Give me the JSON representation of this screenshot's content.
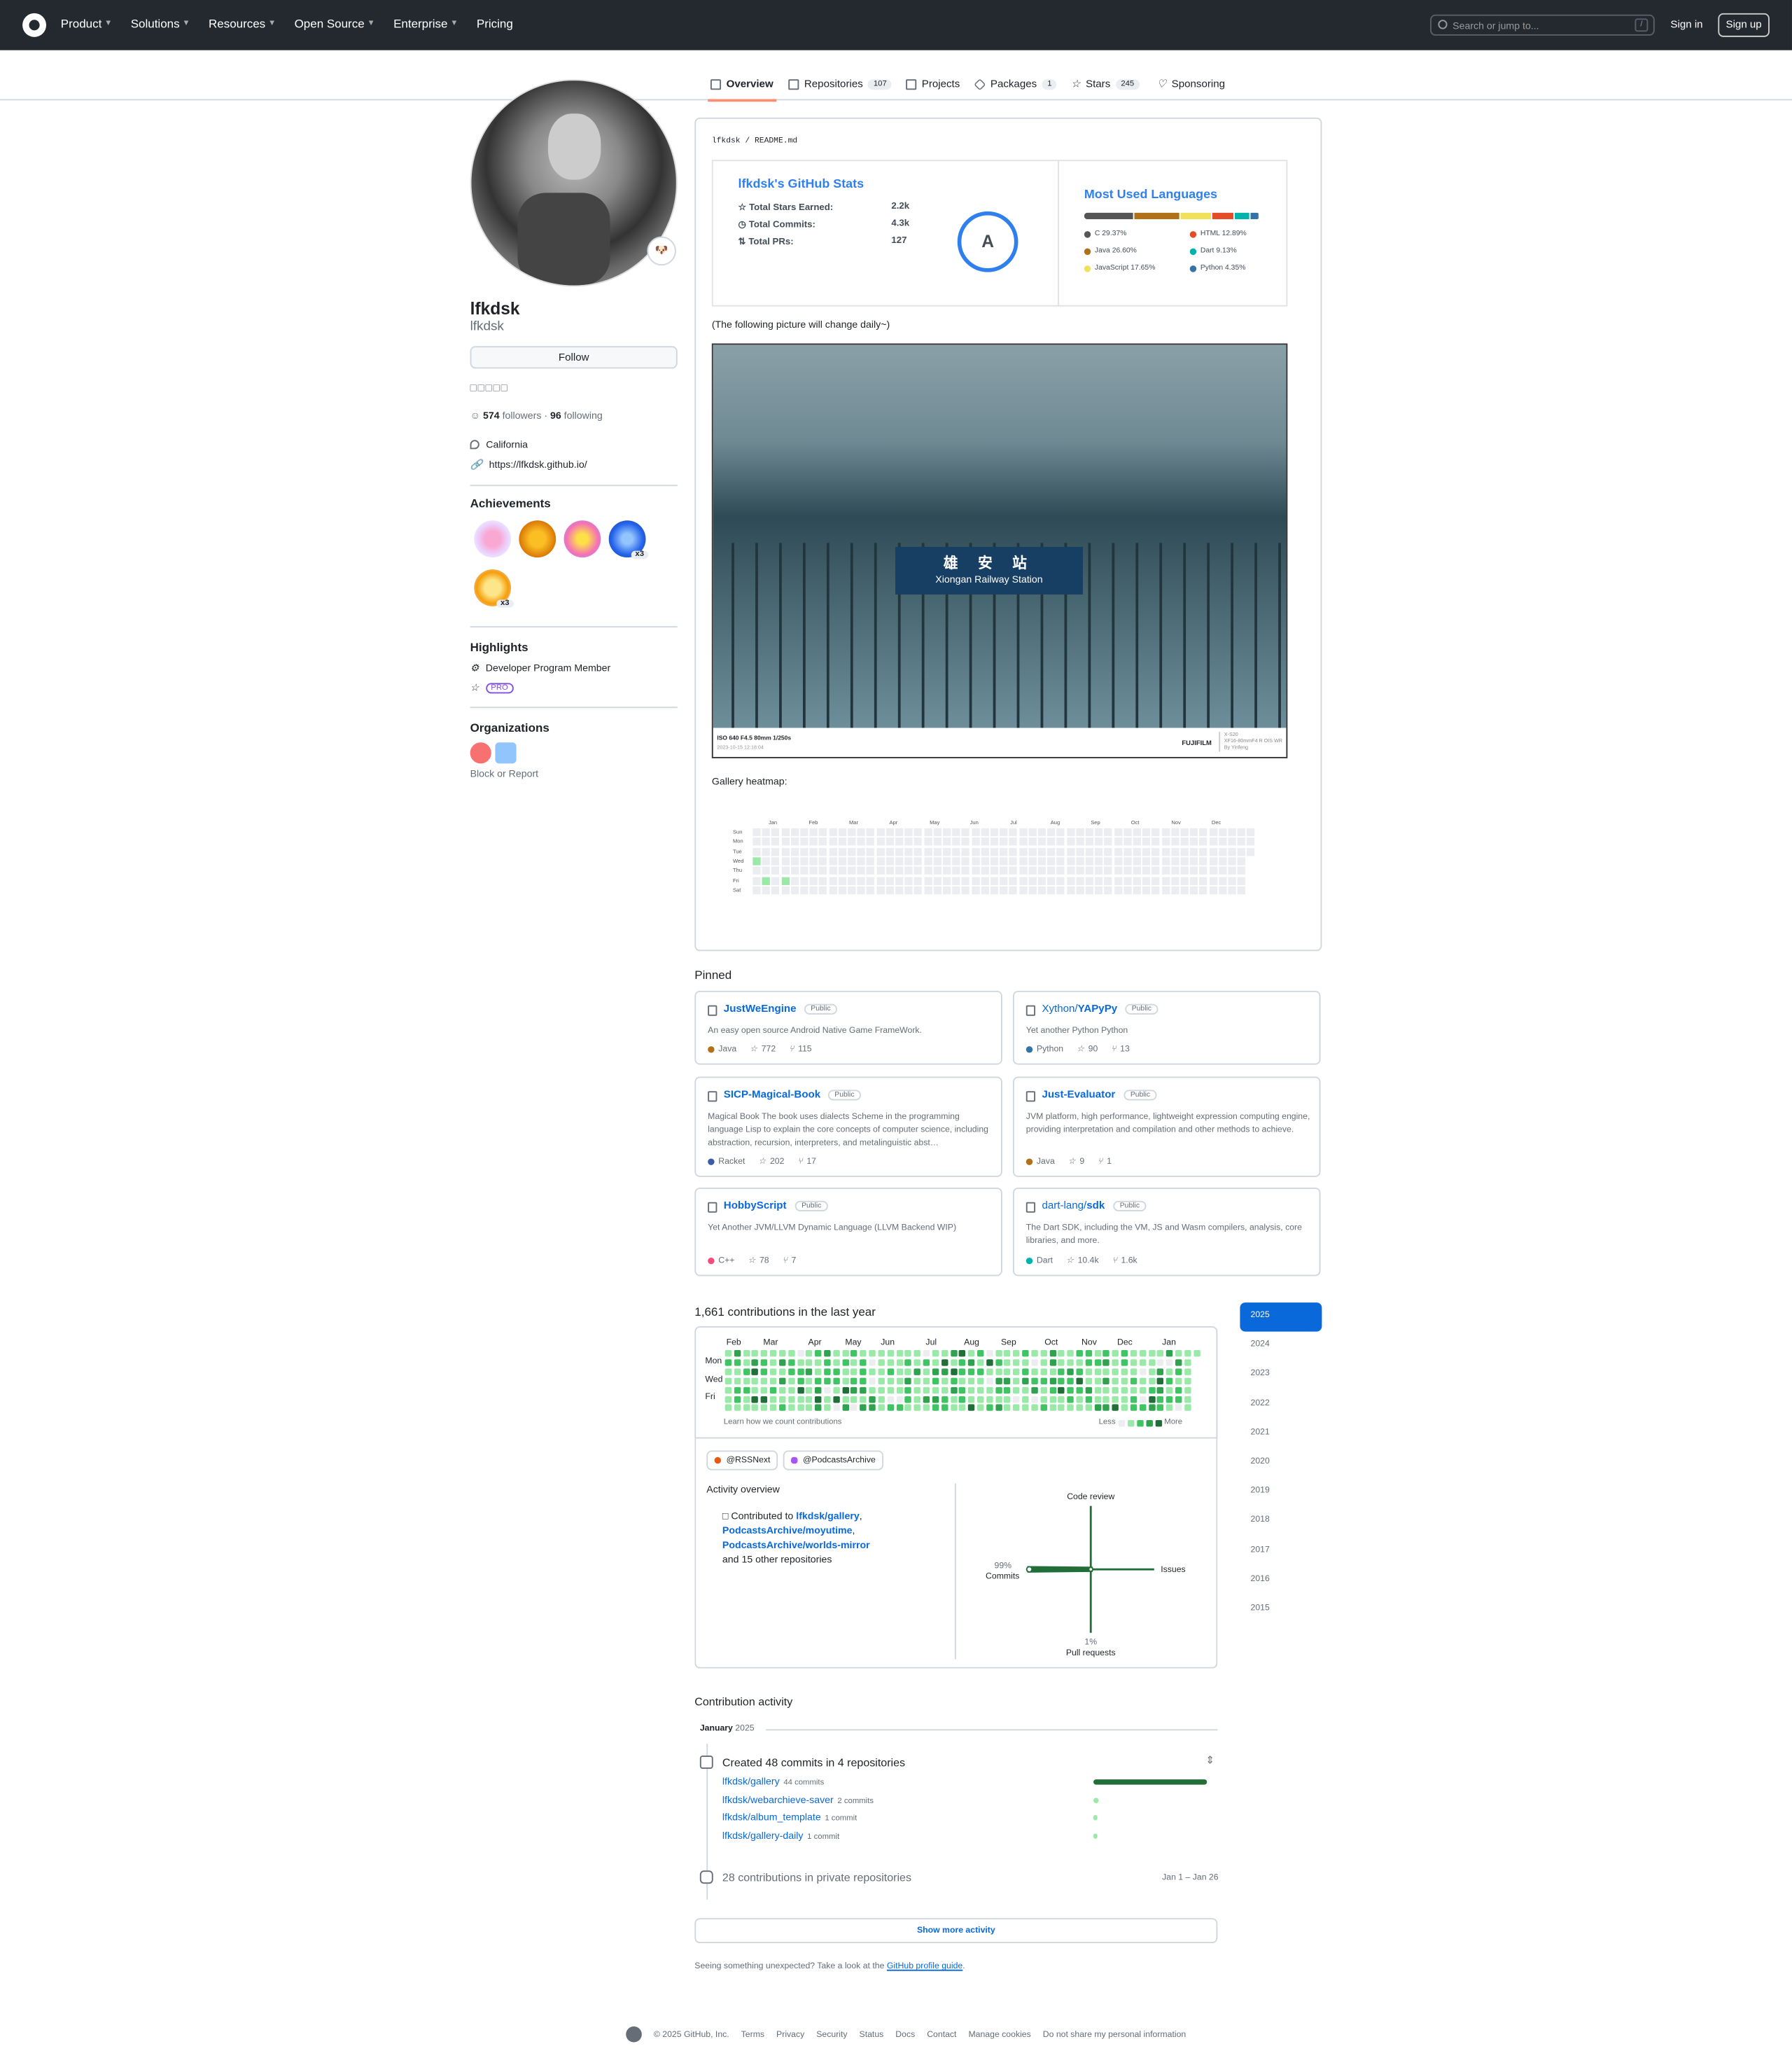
{
  "header": {
    "nav": [
      "Product",
      "Solutions",
      "Resources",
      "Open Source",
      "Enterprise",
      "Pricing"
    ],
    "search_placeholder": "Search or jump to...",
    "search_key": "/",
    "sign_in": "Sign in",
    "sign_up": "Sign up"
  },
  "tabs": [
    {
      "label": "Overview"
    },
    {
      "label": "Repositories",
      "count": "107"
    },
    {
      "label": "Projects"
    },
    {
      "label": "Packages",
      "count": "1"
    },
    {
      "label": "Stars",
      "count": "245"
    },
    {
      "label": "Sponsoring"
    }
  ],
  "profile": {
    "name": "lfkdsk",
    "login": "lfkdsk",
    "follow": "Follow",
    "bio_boxes": "□□□□□",
    "followers": "574",
    "followers_label": "followers",
    "following": "96",
    "following_label": "following",
    "location": "California",
    "website": "https://lfkdsk.github.io/",
    "achievements_title": "Achievements",
    "badge_x3": "x3",
    "highlights_title": "Highlights",
    "highlight_dev": "Developer Program Member",
    "highlight_pro": "PRO",
    "orgs_title": "Organizations",
    "block": "Block or Report"
  },
  "readme": {
    "path_owner": "lfkdsk",
    "path_sep": "/",
    "path_file": "README.md",
    "stats_title": "lfkdsk's GitHub Stats",
    "stars_label": "Total Stars Earned:",
    "stars_val": "2.2k",
    "commits_label": "Total Commits:",
    "commits_val": "4.3k",
    "prs_label": "Total PRs:",
    "prs_val": "127",
    "grade": "A",
    "langs_title": "Most Used Languages",
    "languages": [
      {
        "name": "C 29.37%",
        "color": "#555555",
        "pct": 29.37
      },
      {
        "name": "Java 26.60%",
        "color": "#b07219",
        "pct": 26.6
      },
      {
        "name": "JavaScript 17.65%",
        "color": "#f1e05a",
        "pct": 17.65
      },
      {
        "name": "HTML 12.89%",
        "color": "#e34c26",
        "pct": 12.89
      },
      {
        "name": "Dart 9.13%",
        "color": "#00b4ab",
        "pct": 9.13
      },
      {
        "name": "Python 4.35%",
        "color": "#3572a5",
        "pct": 4.35
      }
    ],
    "picture_note": "(The following picture will change daily~)",
    "sign_cn": "雄 安 站",
    "sign_en": "Xiongan Railway Station",
    "exif": "ISO 640 F4.5 80mm 1/250s",
    "exif_date": "2023-10-15 12:18:04",
    "brand": "FUJIFILM",
    "camera": "X-S20",
    "lens": "XF16-80mmF4 R OIS WR",
    "author": "By Yinfeng",
    "heatmap_label": "Gallery heatmap:",
    "heatmap_months": [
      "Jan",
      "Feb",
      "Mar",
      "Apr",
      "May",
      "Jun",
      "Jul",
      "Aug",
      "Sep",
      "Oct",
      "Nov",
      "Dec"
    ],
    "heatmap_days": [
      "Sun",
      "Mon",
      "Tue",
      "Wed",
      "Thu",
      "Fri",
      "Sat"
    ]
  },
  "pinned": {
    "title": "Pinned",
    "public": "Public",
    "cards": [
      {
        "owner": "",
        "name": "JustWeEngine",
        "desc": "An easy open source Android Native Game FrameWork.",
        "lang": "Java",
        "color": "#b07219",
        "stars": "772",
        "forks": "115"
      },
      {
        "owner": "Xython/",
        "name": "YAPyPy",
        "desc": "Yet another Python Python",
        "lang": "Python",
        "color": "#3572a5",
        "stars": "90",
        "forks": "13"
      },
      {
        "owner": "",
        "name": "SICP-Magical-Book",
        "desc": "Magical Book The book uses dialects Scheme in the programming language Lisp to explain the core concepts of computer science, including abstraction, recursion, interpreters, and metalinguistic abst…",
        "lang": "Racket",
        "color": "#3c5caa",
        "stars": "202",
        "forks": "17"
      },
      {
        "owner": "",
        "name": "Just-Evaluator",
        "desc": "JVM platform, high performance, lightweight expression computing engine, providing interpretation and compilation and other methods to achieve.",
        "lang": "Java",
        "color": "#b07219",
        "stars": "9",
        "forks": "1"
      },
      {
        "owner": "",
        "name": "HobbyScript",
        "desc": "Yet Another JVM/LLVM Dynamic Language (LLVM Backend WIP)",
        "lang": "C++",
        "color": "#f34b7d",
        "stars": "78",
        "forks": "7"
      },
      {
        "owner": "dart-lang/",
        "name": "sdk",
        "desc": "The Dart SDK, including the VM, JS and Wasm compilers, analysis, core libraries, and more.",
        "lang": "Dart",
        "color": "#00b4ab",
        "stars": "10.4k",
        "forks": "1.6k"
      }
    ]
  },
  "contrib": {
    "title": "1,661 contributions in the last year",
    "months": [
      "Feb",
      "Mar",
      "Apr",
      "May",
      "Jun",
      "Jul",
      "Aug",
      "Sep",
      "Oct",
      "Nov",
      "Dec",
      "Jan"
    ],
    "days": [
      "Mon",
      "Wed",
      "Fri"
    ],
    "learn": "Learn how we count contributions",
    "less": "Less",
    "more": "More",
    "org1": "@RSSNext",
    "org2": "@PodcastsArchive",
    "activity_overview": "Activity overview",
    "contributed_to": "Contributed to",
    "repo1": "lfkdsk/gallery",
    "repo2": "PodcastsArchive/moyutime",
    "repo3": "PodcastsArchive/worlds-mirror",
    "others": "and 15 other repositories",
    "code_review": "Code review",
    "issues": "Issues",
    "commits_pct": "99%",
    "commits": "Commits",
    "prs_pct": "1%",
    "prs": "Pull requests",
    "years": [
      "2025",
      "2024",
      "2023",
      "2022",
      "2021",
      "2020",
      "2019",
      "2018",
      "2017",
      "2016",
      "2015"
    ]
  },
  "activity": {
    "title": "Contribution activity",
    "month": "January",
    "year": "2025",
    "created": "Created 48 commits in 4 repositories",
    "repos": [
      {
        "name": "lfkdsk/gallery",
        "count": "44 commits",
        "commits": 44
      },
      {
        "name": "lfkdsk/webarchieve-saver",
        "count": "2 commits",
        "commits": 2
      },
      {
        "name": "lfkdsk/album_template",
        "count": "1 commit",
        "commits": 1
      },
      {
        "name": "lfkdsk/gallery-daily",
        "count": "1 commit",
        "commits": 1
      }
    ],
    "private": "28 contributions in private repositories",
    "private_dates": "Jan 1 – Jan 26",
    "show_more": "Show more activity",
    "unexpected": "Seeing something unexpected? Take a look at the",
    "guide": "GitHub profile guide",
    "dot": "."
  },
  "footer": {
    "copyright": "© 2025 GitHub, Inc.",
    "links": [
      "Terms",
      "Privacy",
      "Security",
      "Status",
      "Docs",
      "Contact",
      "Manage cookies",
      "Do not share my personal information"
    ]
  }
}
